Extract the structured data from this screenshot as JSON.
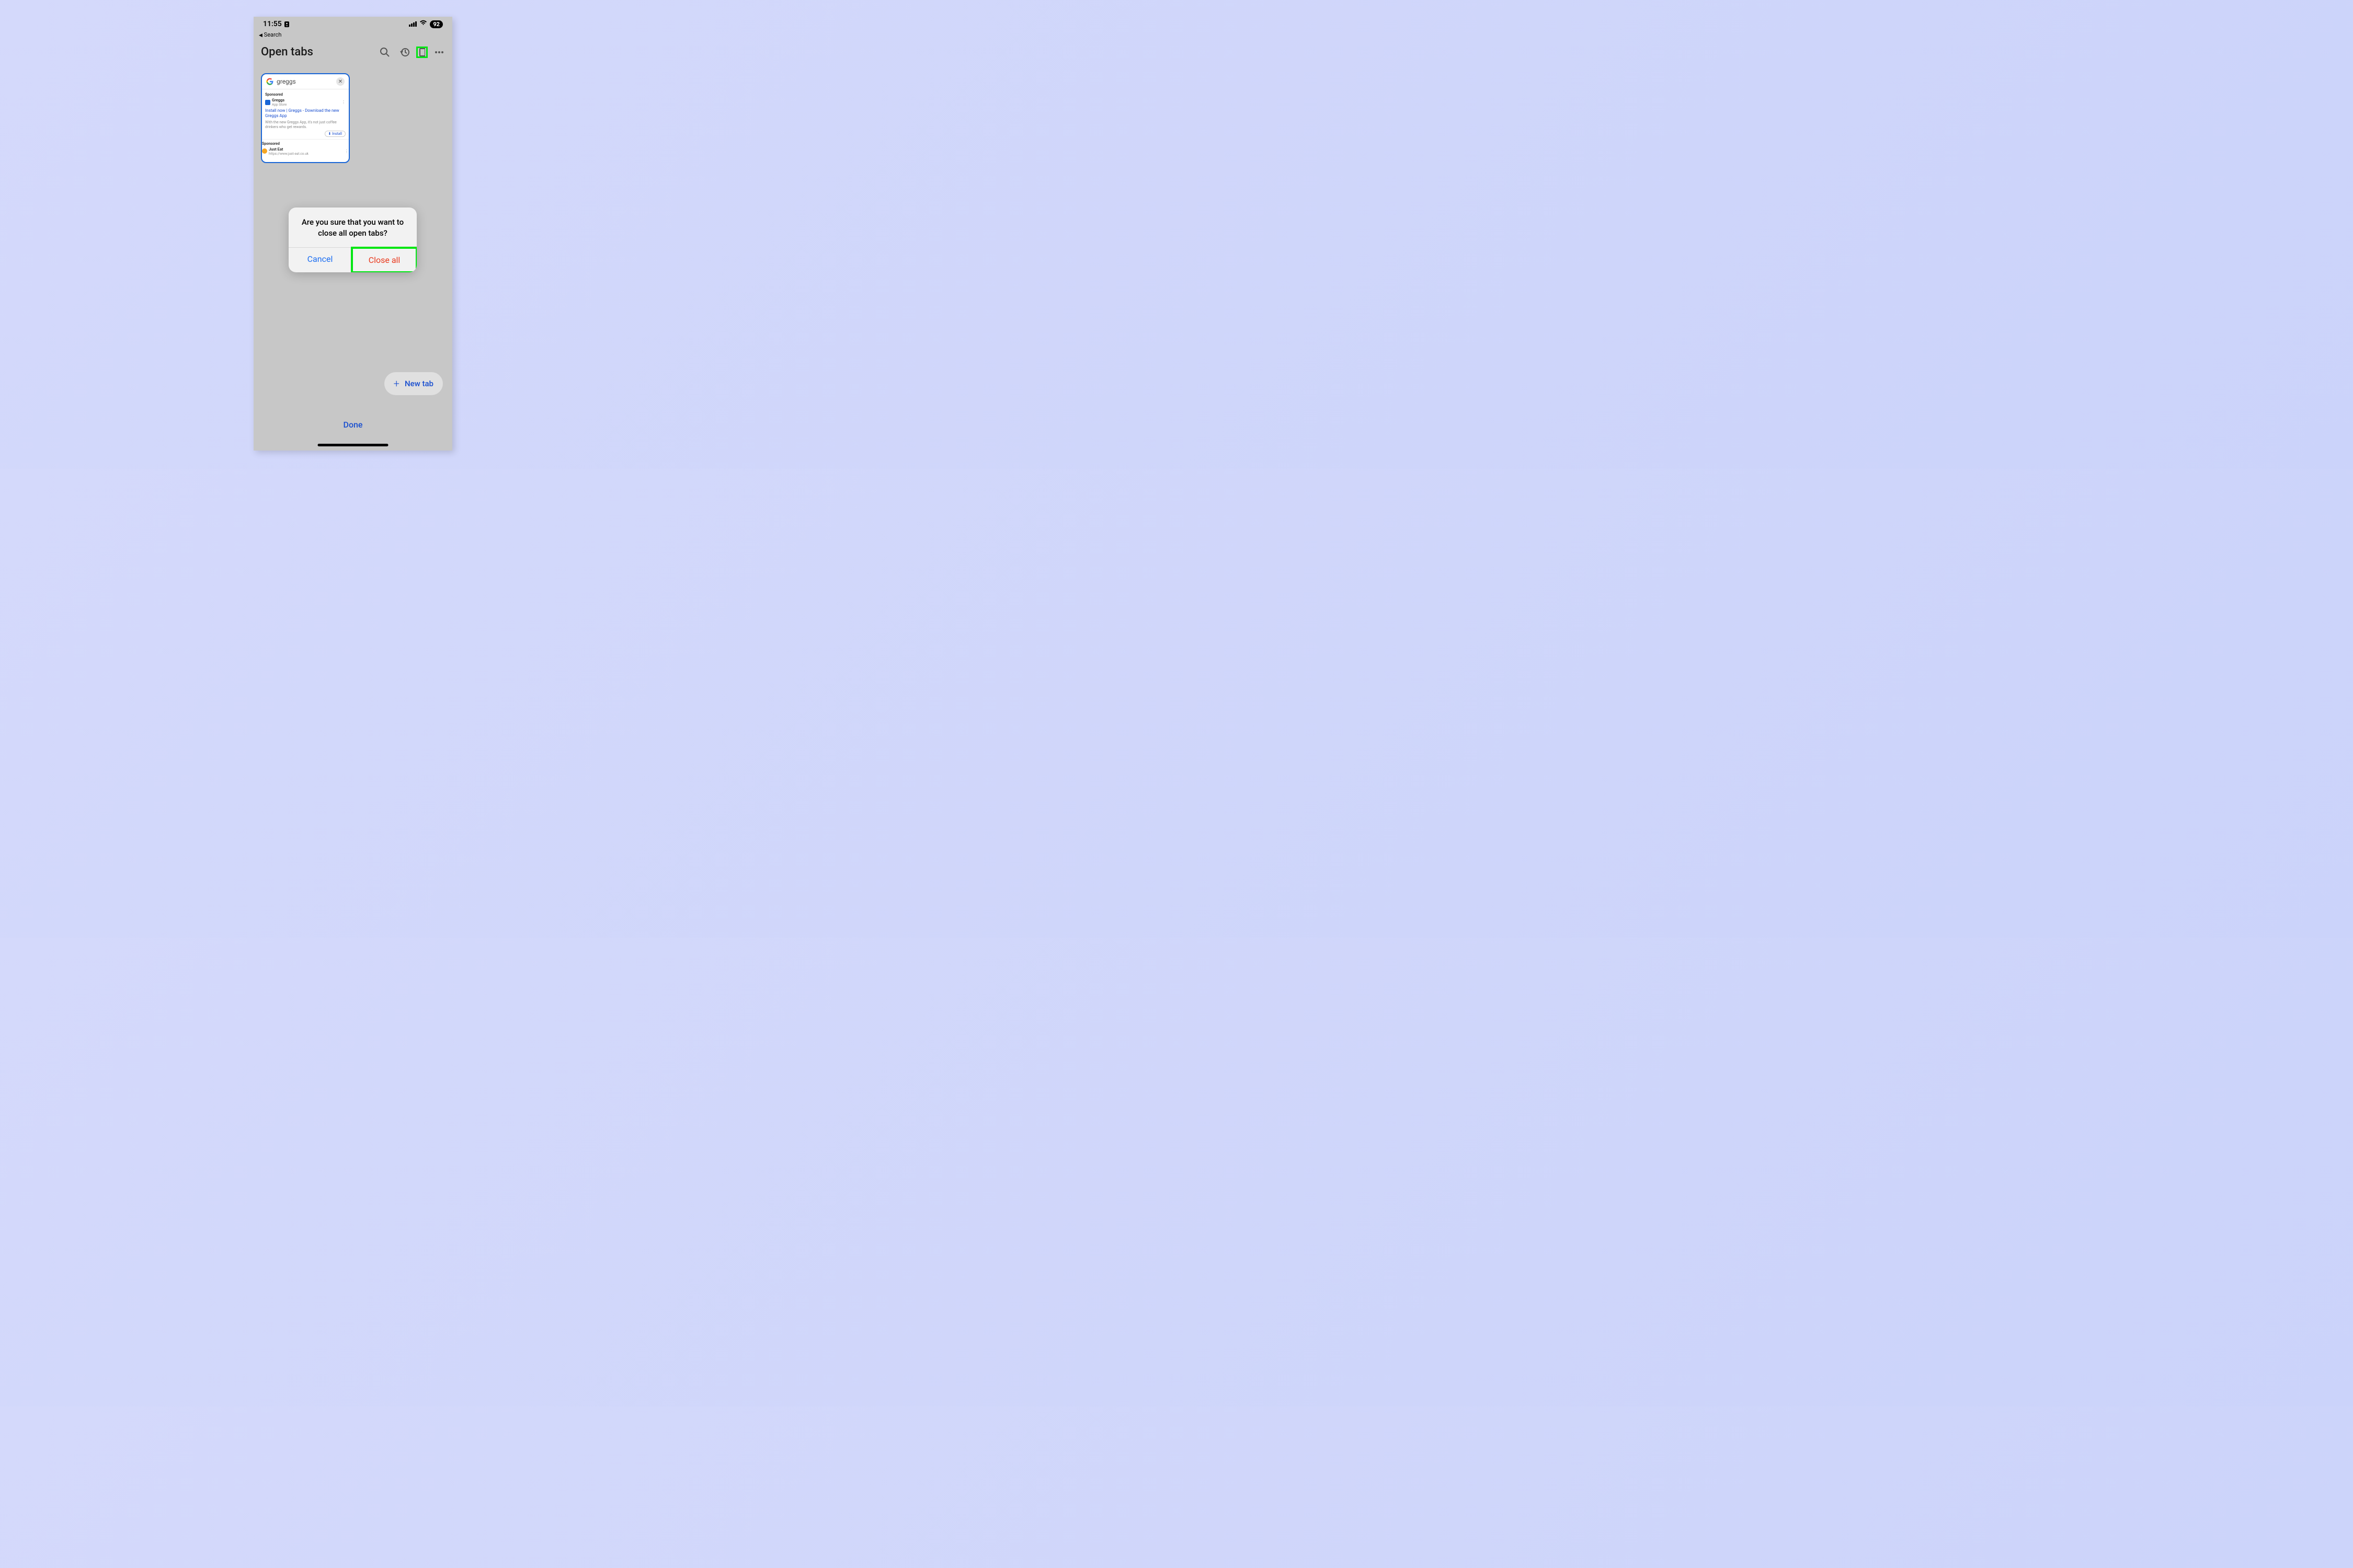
{
  "status": {
    "time": "11:55",
    "battery": "92",
    "back_label": "Search"
  },
  "header": {
    "title": "Open tabs"
  },
  "tab": {
    "title": "greggs",
    "sponsored1": "Sponsored",
    "result1_name": "Greggs",
    "result1_sub": "App Store",
    "bluelink": "Install now | Greggs - Download the new Greggs App",
    "greytext": "With the new Greggs App, it's not just coffee drinkers who get rewards.",
    "install": "Install",
    "sponsored2": "Sponsored",
    "result2_name": "Just Eat",
    "result2_sub": "https://www.just-eat.co.uk"
  },
  "dialog": {
    "message": "Are you sure that you want to close all open tabs?",
    "cancel": "Cancel",
    "close_all": "Close all"
  },
  "footer": {
    "new_tab": "New tab",
    "done": "Done"
  }
}
